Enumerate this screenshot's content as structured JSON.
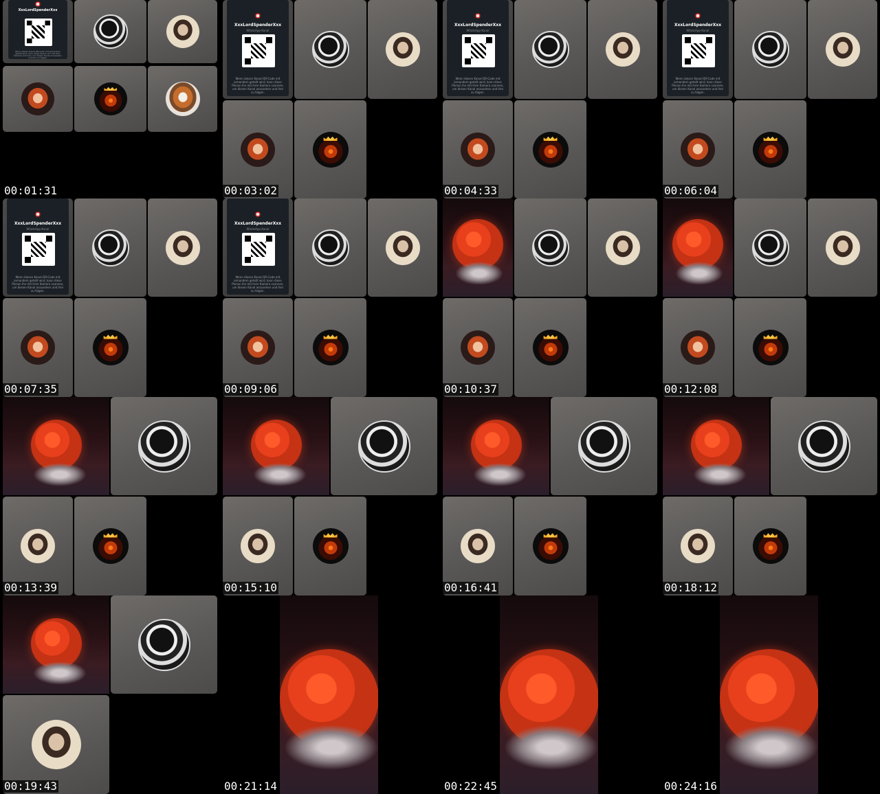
{
  "qr_card": {
    "name": "XxxLordSpenderXxx",
    "subtitle": "WhatsApp-Kanal",
    "caption": "Wenn diesen Kanal-QR-Code mit jemandem geteilt wird, kann diese Person ihn mit ihrer Kamera scannen, um diesen Kanal anzusehen und ihm zu folgen."
  },
  "timestamps": [
    "00:01:31",
    "00:03:02",
    "00:04:33",
    "00:06:04",
    "00:07:35",
    "00:09:06",
    "00:10:37",
    "00:12:08",
    "00:13:39",
    "00:15:10",
    "00:16:41",
    "00:18:12",
    "00:19:43",
    "00:21:14",
    "00:22:45",
    "00:24:16"
  ]
}
